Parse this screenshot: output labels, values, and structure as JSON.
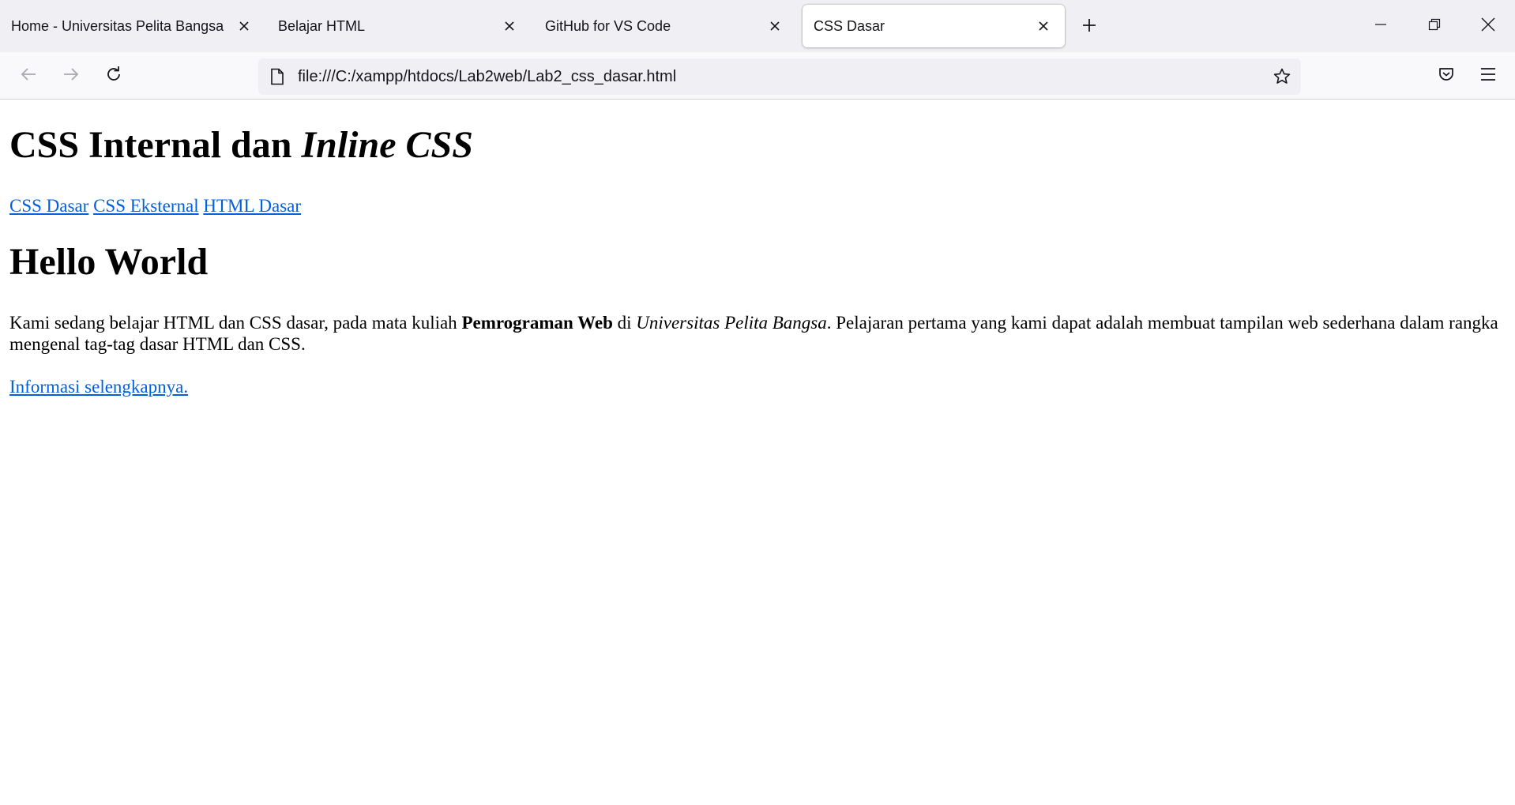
{
  "browser": {
    "tabs": [
      {
        "title": "Home - Universitas Pelita Bangsa",
        "active": false
      },
      {
        "title": "Belajar HTML",
        "active": false
      },
      {
        "title": "GitHub for VS Code",
        "active": false
      },
      {
        "title": "CSS Dasar",
        "active": true
      }
    ],
    "url": "file:///C:/xampp/htdocs/Lab2web/Lab2_css_dasar.html",
    "icons": {
      "tab_close": "close-icon",
      "new_tab": "plus-icon",
      "back": "arrow-left-icon",
      "forward": "arrow-right-icon",
      "reload": "reload-icon",
      "page": "page-icon",
      "bookmark": "star-icon",
      "pocket": "pocket-icon",
      "menu": "hamburger-menu-icon",
      "minimize": "minimize-icon",
      "restore": "restore-icon",
      "close_window": "close-icon"
    },
    "colors": {
      "tabstrip": "#f0f0f4",
      "toolbar": "#f9f9fb",
      "link": "#0060df"
    }
  },
  "page": {
    "heading": {
      "plain": "CSS Internal dan ",
      "italic": "Inline CSS"
    },
    "nav_links": [
      "CSS Dasar",
      "CSS Eksternal",
      "HTML Dasar"
    ],
    "subheading": "Hello World",
    "paragraph": {
      "part1": "Kami sedang belajar HTML dan CSS dasar, pada mata kuliah ",
      "bold": "Pemrograman Web",
      "part2": " di ",
      "italic": "Universitas Pelita Bangsa",
      "part3": ". Pelajaran pertama yang kami dapat adalah membuat tampilan web sederhana dalam rangka mengenal tag-tag dasar HTML dan CSS."
    },
    "more_link": "Informasi selengkapnya."
  }
}
